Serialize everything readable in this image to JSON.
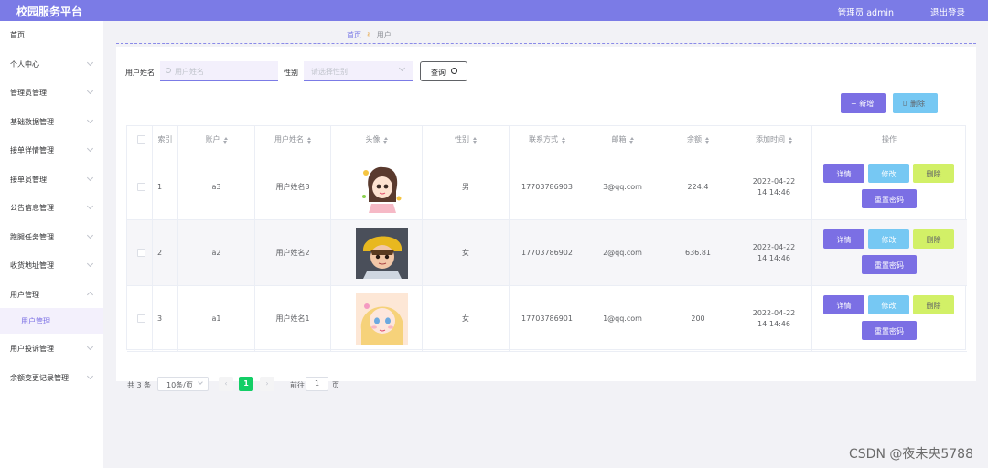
{
  "header": {
    "title": "校园服务平台",
    "user": "管理员 admin",
    "logout": "退出登录"
  },
  "sidebar": [
    {
      "label": "首页"
    },
    {
      "label": "个人中心"
    },
    {
      "label": "管理员管理"
    },
    {
      "label": "基础数据管理"
    },
    {
      "label": "接单详情管理"
    },
    {
      "label": "接单员管理"
    },
    {
      "label": "公告信息管理"
    },
    {
      "label": "跑腿任务管理"
    },
    {
      "label": "收货地址管理"
    },
    {
      "label": "用户管理"
    },
    {
      "label": "用户管理"
    },
    {
      "label": "用户投诉管理"
    },
    {
      "label": "余额变更记录管理"
    }
  ],
  "breadcrumb": {
    "home": "首页",
    "sep": "✌",
    "current": "用户"
  },
  "filters": {
    "name_label": "用户姓名",
    "name_placeholder": "用户姓名",
    "gender_label": "性别",
    "gender_placeholder": "请选择性别",
    "query_button": "查询"
  },
  "toolbar": {
    "add": "+ 新增",
    "delete": "删除"
  },
  "table": {
    "headers": [
      "索引",
      "账户",
      "用户姓名",
      "头像",
      "性别",
      "联系方式",
      "邮箱",
      "余额",
      "添加时间",
      "操作"
    ],
    "rows": [
      {
        "index": "1",
        "account": "a3",
        "name": "用户姓名3",
        "gender": "男",
        "phone": "17703786903",
        "email": "3@qq.com",
        "balance": "224.4",
        "time": "2022-04-22 14:14:46"
      },
      {
        "index": "2",
        "account": "a2",
        "name": "用户姓名2",
        "gender": "女",
        "phone": "17703786902",
        "email": "2@qq.com",
        "balance": "636.81",
        "time": "2022-04-22 14:14:46"
      },
      {
        "index": "3",
        "account": "a1",
        "name": "用户姓名1",
        "gender": "女",
        "phone": "17703786901",
        "email": "1@qq.com",
        "balance": "200",
        "time": "2022-04-22 14:14:46"
      }
    ],
    "actions": {
      "detail": "详情",
      "edit": "修改",
      "delete": "删除",
      "reset": "重置密码"
    }
  },
  "pagination": {
    "total": "共 3 条",
    "page_size": "10条/页",
    "current_page": "1",
    "goto_label": "前往",
    "goto_value": "1",
    "page_suffix": "页"
  },
  "watermark": "CSDN @夜未央5788",
  "colors": {
    "brand": "#7b7be6",
    "purple_button": "#7b6fe4",
    "blue_button": "#76c8f3",
    "lime_button": "#d2f067",
    "pager_active": "#13ce66"
  }
}
